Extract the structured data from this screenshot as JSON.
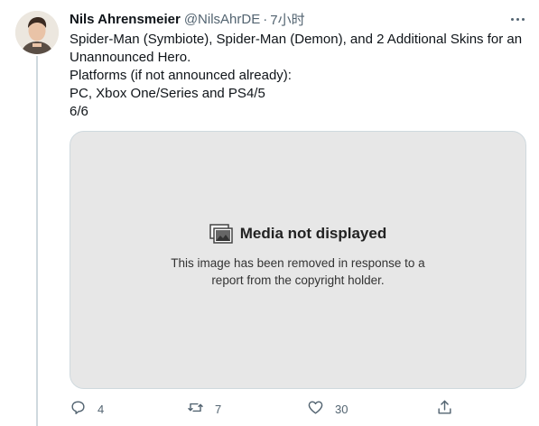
{
  "tweet": {
    "author_name": "Nils Ahrensmeier",
    "handle": "@NilsAhrDE",
    "separator": "·",
    "time": "7小时",
    "body_lines": [
      "Spider-Man (Symbiote), Spider-Man (Demon), and 2 Additional Skins for an",
      "Unannounced Hero.",
      "Platforms (if not announced already):",
      "PC, Xbox One/Series and PS4/5",
      "6/6"
    ]
  },
  "media": {
    "title": "Media not displayed",
    "description_lines": [
      "This image has been removed in response to a",
      "report from the copyright holder."
    ]
  },
  "actions": {
    "reply_count": "4",
    "retweet_count": "7",
    "like_count": "30",
    "share_count": ""
  },
  "icons": {
    "more": "more-horizontal-icon",
    "media_placeholder": "images-icon",
    "reply": "reply-icon",
    "retweet": "retweet-icon",
    "like": "heart-icon",
    "share": "share-icon"
  },
  "colors": {
    "text_primary": "#0f1419",
    "text_secondary": "#536471",
    "media_bg": "#e7e7e7",
    "border": "#cfd9de"
  }
}
